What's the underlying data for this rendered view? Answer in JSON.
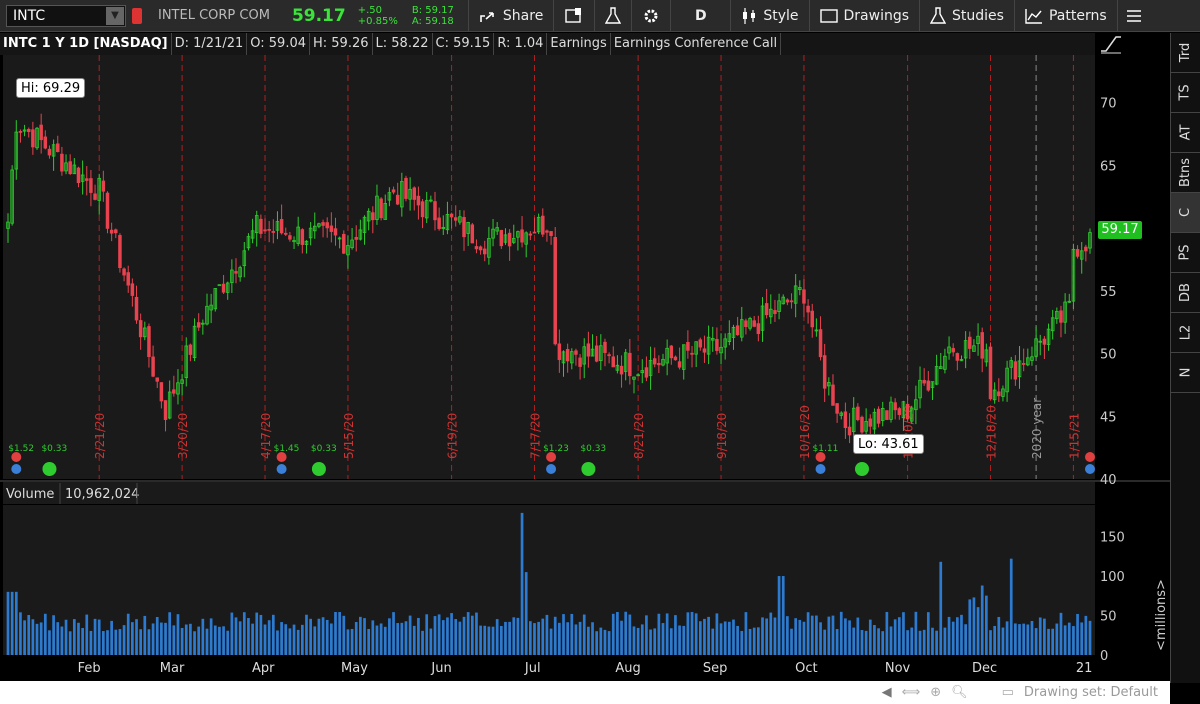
{
  "toolbar": {
    "symbol": "INTC",
    "company": "INTEL CORP COM",
    "last": "59.17",
    "change": "+.50",
    "change_pct": "+0.85%",
    "bid": "B: 59.17",
    "ask": "A: 59.18",
    "share": "Share",
    "period": "D",
    "style": "Style",
    "drawings": "Drawings",
    "studies": "Studies",
    "patterns": "Patterns"
  },
  "header": {
    "title": "INTC 1 Y 1D [NASDAQ]",
    "date": "D: 1/21/21",
    "open": "O: 59.04",
    "high": "H: 59.26",
    "low": "L: 58.22",
    "close": "C: 59.15",
    "range": "R: 1.04",
    "earnings": "Earnings",
    "conference": "Earnings Conference Call"
  },
  "side_tabs": [
    "Trd",
    "TS",
    "AT",
    "Btns",
    "C",
    "PS",
    "DB",
    "L2",
    "N"
  ],
  "price_tag": "59.17",
  "hi_label": "Hi: 69.29",
  "lo_label": "Lo: 43.61",
  "volume_label": "Volume",
  "volume_value": "10,962,024",
  "millions_label": "<millions>",
  "drawing_set": "Drawing set: Default",
  "colors": {
    "up": "#2ecc2e",
    "down": "#e8434f",
    "volume": "#2c7bd1",
    "earn_line": "#b02020",
    "year_line": "#888888"
  },
  "chart_data": {
    "type": "candlestick",
    "price_axis": {
      "min": 40,
      "max": 73,
      "ticks": [
        40,
        45,
        50,
        55,
        60,
        65,
        70
      ]
    },
    "volume_axis": {
      "min": 0,
      "max": 190,
      "ticks": [
        0,
        50,
        100,
        150
      ]
    },
    "months": [
      "Feb",
      "Mar",
      "Apr",
      "May",
      "Jun",
      "Jul",
      "Aug",
      "Sep",
      "Oct",
      "Nov",
      "Dec",
      "21"
    ],
    "earnings_dates": [
      "2/21/20",
      "3/20/20",
      "4/17/20",
      "5/15/20",
      "6/19/20",
      "7/17/20",
      "8/21/20",
      "9/18/20",
      "10/16/20",
      "11/20/20",
      "12/18/20",
      "1/15/21"
    ],
    "year_marker": "2020 year",
    "dividends": [
      "$1.52",
      "$0.33",
      "$1.45",
      "$0.33",
      "$1.23",
      "$0.33",
      "$1.11",
      "$0.33"
    ],
    "key_points": [
      {
        "date": "1/22/20",
        "close": 60.5
      },
      {
        "date": "1/24/20",
        "close": 68.5
      },
      {
        "date": "2/21/20",
        "close": 63.0
      },
      {
        "date": "3/16/20",
        "close": 45.5
      },
      {
        "date": "3/27/20",
        "close": 53.0
      },
      {
        "date": "4/15/20",
        "close": 60.0
      },
      {
        "date": "5/15/20",
        "close": 59.0
      },
      {
        "date": "6/1/20",
        "close": 63.0
      },
      {
        "date": "7/1/20",
        "close": 59.0
      },
      {
        "date": "7/23/20",
        "close": 60.5
      },
      {
        "date": "7/24/20",
        "close": 50.5
      },
      {
        "date": "8/21/20",
        "close": 49.0
      },
      {
        "date": "9/18/20",
        "close": 50.5
      },
      {
        "date": "10/16/20",
        "close": 55.0
      },
      {
        "date": "10/23/20",
        "close": 48.0
      },
      {
        "date": "10/30/20",
        "close": 44.5
      },
      {
        "date": "11/20/20",
        "close": 45.5
      },
      {
        "date": "12/4/20",
        "close": 50.5
      },
      {
        "date": "12/17/20",
        "close": 50.5
      },
      {
        "date": "12/18/20",
        "close": 47.0
      },
      {
        "date": "1/8/21",
        "close": 52.0
      },
      {
        "date": "1/14/21",
        "close": 53.5
      },
      {
        "date": "1/15/21",
        "close": 58.5
      },
      {
        "date": "1/21/21",
        "close": 59.15
      }
    ]
  }
}
